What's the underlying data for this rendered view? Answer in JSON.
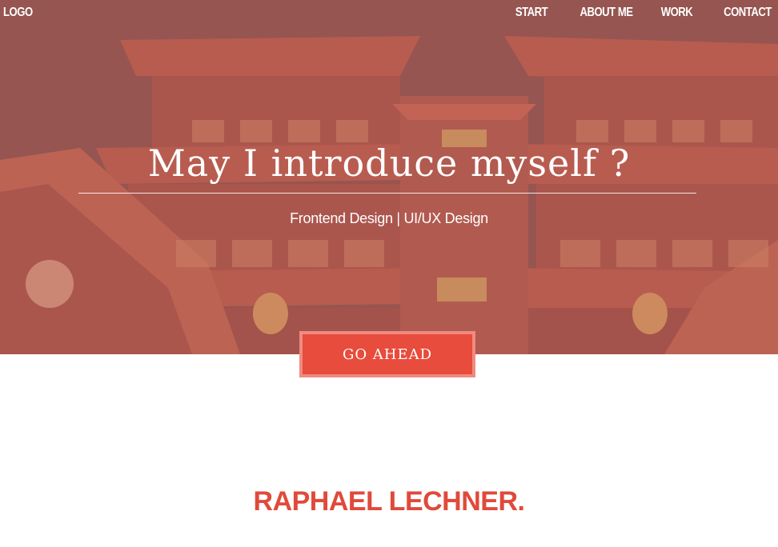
{
  "nav": {
    "logo": "LOGO",
    "links": [
      "START",
      "ABOUT ME",
      "WORK",
      "CONTACT"
    ]
  },
  "hero": {
    "title": "May I introduce myself ?",
    "subtitle": "Frontend Design | UI/UX Design",
    "button_label": "GO AHEAD",
    "background_image": "temple-photo"
  },
  "about": {
    "name": "RAPHAEL LECHNER."
  },
  "colors": {
    "accent": "#e74c3c",
    "accent_border": "#f08a80",
    "name_text": "#e04a3b",
    "overlay": "#c47870"
  }
}
